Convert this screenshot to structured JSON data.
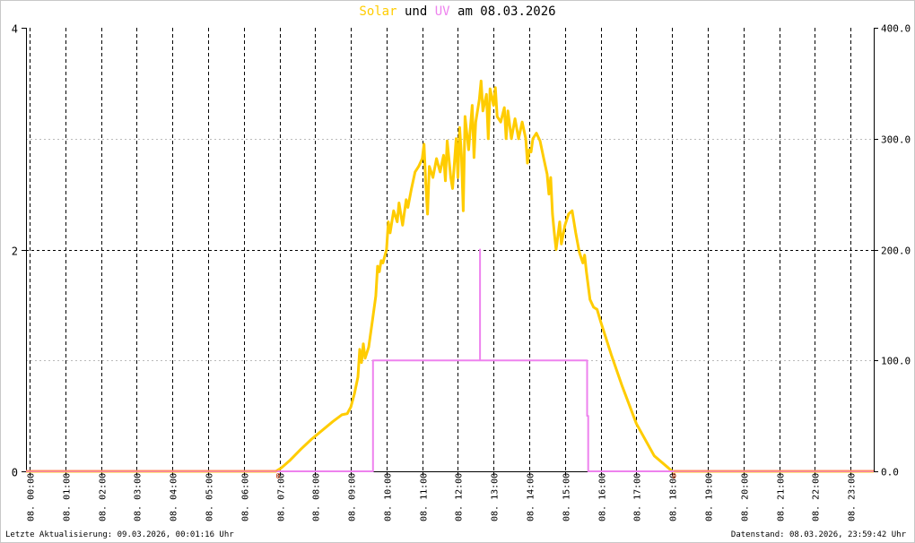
{
  "header": {
    "title_solar": "Solar",
    "title_und": "und",
    "title_uv": "UV",
    "title_rest": "am 08.03.2026"
  },
  "footer": {
    "left": "Letzte Aktualisierung: 09.03.2026, 00:01:16 Uhr",
    "right": "Datenstand: 08.03.2026, 23:59:42 Uhr"
  },
  "colors": {
    "solar": "#ffcc00",
    "uv": "#ee82ee",
    "baseline": "#ff8c69",
    "grid": "#000000",
    "grid_minor": "#bbbbbb"
  },
  "chart_data": {
    "type": "line",
    "x_ticks": [
      "08. 00:00",
      "08. 01:00",
      "08. 02:00",
      "08. 03:00",
      "08. 04:00",
      "08. 05:00",
      "08. 06:00",
      "08. 07:00",
      "08. 08:00",
      "08. 09:00",
      "08. 10:00",
      "08. 11:00",
      "08. 12:00",
      "08. 13:00",
      "08. 14:00",
      "08. 15:00",
      "08. 16:00",
      "08. 17:00",
      "08. 18:00",
      "08. 19:00",
      "08. 20:00",
      "08. 21:00",
      "08. 22:00",
      "08. 23:00"
    ],
    "x_tick_hours": [
      0,
      1,
      2,
      3,
      4,
      5,
      6,
      7,
      8,
      9,
      10,
      11,
      12,
      13,
      14,
      15,
      16,
      17,
      18,
      19,
      20,
      21,
      22,
      23
    ],
    "xlim": [
      -0.1,
      23.65
    ],
    "left_axis": {
      "ticks": [
        "0",
        "2",
        "4"
      ],
      "values": [
        0,
        2,
        4
      ],
      "ylim": [
        0,
        4
      ]
    },
    "right_axis": {
      "ticks": [
        "0.0",
        "100.0",
        "200.0",
        "300.0",
        "400.0"
      ],
      "values": [
        0,
        100,
        200,
        300,
        400
      ],
      "ylim": [
        0,
        400
      ]
    },
    "zero_markers": [
      {
        "label": "0",
        "hour": 6.95
      },
      {
        "label": "0",
        "hour": 18.05
      }
    ],
    "series": [
      {
        "name": "Solar",
        "axis": "right",
        "points": [
          [
            -0.1,
            0
          ],
          [
            6.9,
            0
          ],
          [
            7.05,
            3
          ],
          [
            7.3,
            10
          ],
          [
            7.6,
            20
          ],
          [
            7.9,
            29
          ],
          [
            8.2,
            37
          ],
          [
            8.5,
            45
          ],
          [
            8.75,
            51
          ],
          [
            8.9,
            52
          ],
          [
            9.0,
            58
          ],
          [
            9.1,
            70
          ],
          [
            9.2,
            85
          ],
          [
            9.25,
            110
          ],
          [
            9.3,
            98
          ],
          [
            9.35,
            115
          ],
          [
            9.4,
            102
          ],
          [
            9.5,
            112
          ],
          [
            9.6,
            135
          ],
          [
            9.7,
            158
          ],
          [
            9.75,
            185
          ],
          [
            9.8,
            180
          ],
          [
            9.85,
            190
          ],
          [
            9.9,
            188
          ],
          [
            10.0,
            200
          ],
          [
            10.05,
            225
          ],
          [
            10.1,
            215
          ],
          [
            10.2,
            235
          ],
          [
            10.3,
            225
          ],
          [
            10.35,
            242
          ],
          [
            10.45,
            222
          ],
          [
            10.55,
            245
          ],
          [
            10.6,
            238
          ],
          [
            10.7,
            255
          ],
          [
            10.8,
            270
          ],
          [
            10.9,
            275
          ],
          [
            11.0,
            282
          ],
          [
            11.05,
            295
          ],
          [
            11.1,
            260
          ],
          [
            11.15,
            232
          ],
          [
            11.2,
            275
          ],
          [
            11.3,
            265
          ],
          [
            11.4,
            282
          ],
          [
            11.5,
            270
          ],
          [
            11.6,
            285
          ],
          [
            11.65,
            262
          ],
          [
            11.7,
            298
          ],
          [
            11.8,
            265
          ],
          [
            11.85,
            255
          ],
          [
            11.95,
            300
          ],
          [
            12.0,
            265
          ],
          [
            12.05,
            310
          ],
          [
            12.1,
            285
          ],
          [
            12.15,
            235
          ],
          [
            12.2,
            320
          ],
          [
            12.3,
            290
          ],
          [
            12.4,
            330
          ],
          [
            12.45,
            283
          ],
          [
            12.5,
            315
          ],
          [
            12.6,
            335
          ],
          [
            12.65,
            352
          ],
          [
            12.7,
            325
          ],
          [
            12.8,
            340
          ],
          [
            12.85,
            300
          ],
          [
            12.9,
            345
          ],
          [
            13.0,
            330
          ],
          [
            13.05,
            346
          ],
          [
            13.1,
            320
          ],
          [
            13.2,
            315
          ],
          [
            13.3,
            328
          ],
          [
            13.35,
            300
          ],
          [
            13.4,
            325
          ],
          [
            13.5,
            300
          ],
          [
            13.6,
            318
          ],
          [
            13.7,
            300
          ],
          [
            13.8,
            315
          ],
          [
            13.9,
            300
          ],
          [
            13.95,
            278
          ],
          [
            14.0,
            290
          ],
          [
            14.05,
            288
          ],
          [
            14.1,
            300
          ],
          [
            14.2,
            305
          ],
          [
            14.3,
            298
          ],
          [
            14.4,
            283
          ],
          [
            14.5,
            268
          ],
          [
            14.55,
            250
          ],
          [
            14.6,
            265
          ],
          [
            14.65,
            232
          ],
          [
            14.7,
            215
          ],
          [
            14.75,
            200
          ],
          [
            14.8,
            212
          ],
          [
            14.85,
            225
          ],
          [
            14.9,
            205
          ],
          [
            15.0,
            222
          ],
          [
            15.1,
            232
          ],
          [
            15.2,
            235
          ],
          [
            15.3,
            215
          ],
          [
            15.4,
            198
          ],
          [
            15.5,
            188
          ],
          [
            15.55,
            195
          ],
          [
            15.6,
            180
          ],
          [
            15.7,
            155
          ],
          [
            15.8,
            148
          ],
          [
            15.9,
            146
          ],
          [
            16.0,
            135
          ],
          [
            16.3,
            105
          ],
          [
            16.6,
            77
          ],
          [
            17.0,
            43
          ],
          [
            17.5,
            14
          ],
          [
            17.9,
            3
          ],
          [
            18.0,
            0
          ],
          [
            23.65,
            0
          ]
        ]
      },
      {
        "name": "UV",
        "axis": "left",
        "points": [
          [
            -0.1,
            0
          ],
          [
            9.62,
            0
          ],
          [
            9.62,
            1
          ],
          [
            12.62,
            1
          ],
          [
            12.62,
            2
          ],
          [
            12.62,
            1
          ],
          [
            15.62,
            1
          ],
          [
            15.62,
            0.5
          ],
          [
            15.65,
            0.5
          ],
          [
            15.65,
            0
          ],
          [
            23.65,
            0
          ]
        ]
      }
    ]
  }
}
